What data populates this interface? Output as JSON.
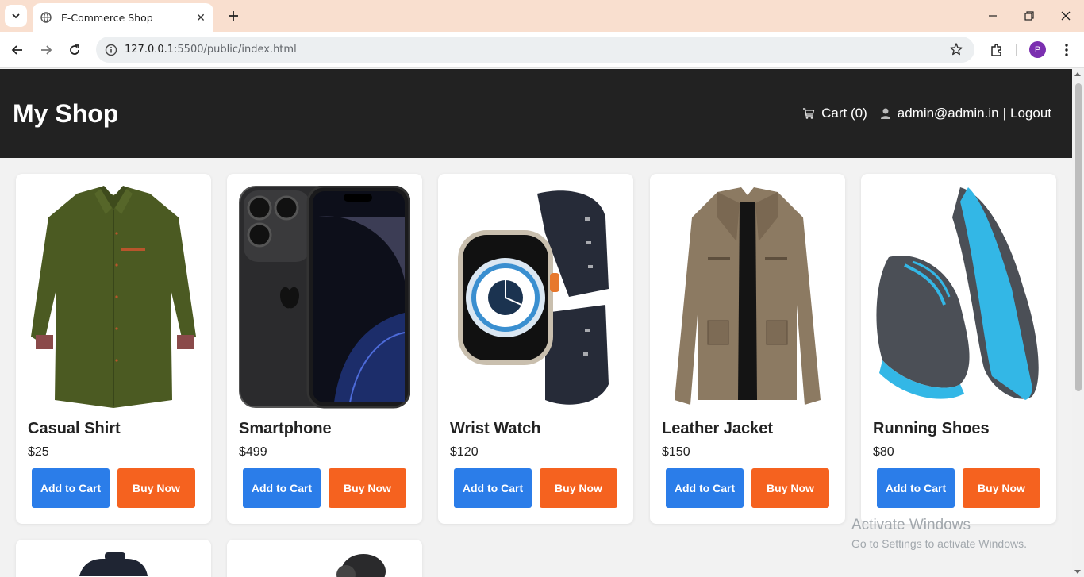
{
  "browser": {
    "tab_title": "E-Commerce Shop",
    "url_host": "127.0.0.1",
    "url_path": ":5500/public/index.html",
    "profile_initial": "P"
  },
  "header": {
    "logo": "My Shop",
    "cart_label": "Cart (0)",
    "user_email": "admin@admin.in",
    "separator": "|",
    "logout_label": "Logout"
  },
  "products": [
    {
      "name": "Casual Shirt",
      "price": "$25",
      "add_label": "Add to Cart",
      "buy_label": "Buy Now"
    },
    {
      "name": "Smartphone",
      "price": "$499",
      "add_label": "Add to Cart",
      "buy_label": "Buy Now"
    },
    {
      "name": "Wrist Watch",
      "price": "$120",
      "add_label": "Add to Cart",
      "buy_label": "Buy Now"
    },
    {
      "name": "Leather Jacket",
      "price": "$150",
      "add_label": "Add to Cart",
      "buy_label": "Buy Now"
    },
    {
      "name": "Running Shoes",
      "price": "$80",
      "add_label": "Add to Cart",
      "buy_label": "Buy Now"
    }
  ],
  "watermark": {
    "line1": "Activate Windows",
    "line2": "Go to Settings to activate Windows."
  },
  "colors": {
    "header_bg": "#222222",
    "add_button": "#2b7de9",
    "buy_button": "#f5621f",
    "tabbar": "#f9dfcf"
  }
}
